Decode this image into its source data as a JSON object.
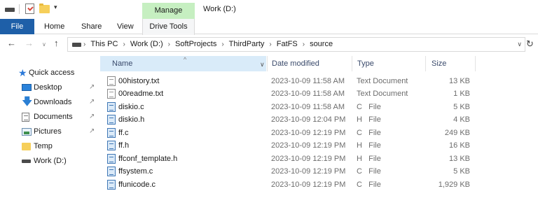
{
  "titlebar": {
    "manage_tab": "Manage",
    "window_title": "Work (D:)",
    "quick_access_dropdown": "▾"
  },
  "ribbon": {
    "tabs": [
      "File",
      "Home",
      "Share",
      "View",
      "Drive Tools"
    ]
  },
  "address": {
    "back": "←",
    "forward": "→",
    "recent": "∨",
    "up": "↑",
    "crumbs": [
      "This PC",
      "Work (D:)",
      "SoftProjects",
      "ThirdParty",
      "FatFS",
      "source"
    ],
    "separator": "›",
    "chevron": "∨",
    "refresh": "↻"
  },
  "navpane": {
    "quick_access": "Quick access",
    "items": [
      {
        "label": "Desktop",
        "icon": "desktop-icon",
        "pinned": true
      },
      {
        "label": "Downloads",
        "icon": "downloads-icon",
        "pinned": true
      },
      {
        "label": "Documents",
        "icon": "documents-icon",
        "pinned": true
      },
      {
        "label": "Pictures",
        "icon": "pictures-icon",
        "pinned": true
      },
      {
        "label": "Temp",
        "icon": "folder-icon",
        "pinned": false
      },
      {
        "label": "Work (D:)",
        "icon": "drive-icon",
        "pinned": false
      }
    ],
    "pin_glyph": "↗"
  },
  "filelist": {
    "columns": {
      "name": "Name",
      "date": "Date modified",
      "type": "Type",
      "size": "Size"
    },
    "sort_indicator": "^",
    "name_chevron": "∨",
    "files": [
      {
        "name": "00history.txt",
        "date": "2023-10-09 11:58 AM",
        "type": "Text Document",
        "size": "13 KB",
        "icon": "text-file-icon"
      },
      {
        "name": "00readme.txt",
        "date": "2023-10-09 11:58 AM",
        "type": "Text Document",
        "size": "1 KB",
        "icon": "text-file-icon"
      },
      {
        "name": "diskio.c",
        "date": "2023-10-09 11:58 AM",
        "type": "C   File",
        "size": "5 KB",
        "icon": "c-source-icon"
      },
      {
        "name": "diskio.h",
        "date": "2023-10-09 12:04 PM",
        "type": "H   File",
        "size": "4 KB",
        "icon": "c-header-icon"
      },
      {
        "name": "ff.c",
        "date": "2023-10-09 12:19 PM",
        "type": "C   File",
        "size": "249 KB",
        "icon": "c-source-icon"
      },
      {
        "name": "ff.h",
        "date": "2023-10-09 12:19 PM",
        "type": "H   File",
        "size": "16 KB",
        "icon": "c-header-icon"
      },
      {
        "name": "ffconf_template.h",
        "date": "2023-10-09 12:19 PM",
        "type": "H   File",
        "size": "13 KB",
        "icon": "c-header-icon"
      },
      {
        "name": "ffsystem.c",
        "date": "2023-10-09 12:19 PM",
        "type": "C   File",
        "size": "5 KB",
        "icon": "c-source-icon"
      },
      {
        "name": "ffunicode.c",
        "date": "2023-10-09 12:19 PM",
        "type": "C   File",
        "size": "1,929 KB",
        "icon": "c-source-icon"
      }
    ]
  },
  "colors": {
    "file_tab": "#1e5fa8",
    "manage_tab": "#c6efc1",
    "name_header_highlight": "#d9ebf9",
    "quick_access_star": "#2b79d8"
  }
}
